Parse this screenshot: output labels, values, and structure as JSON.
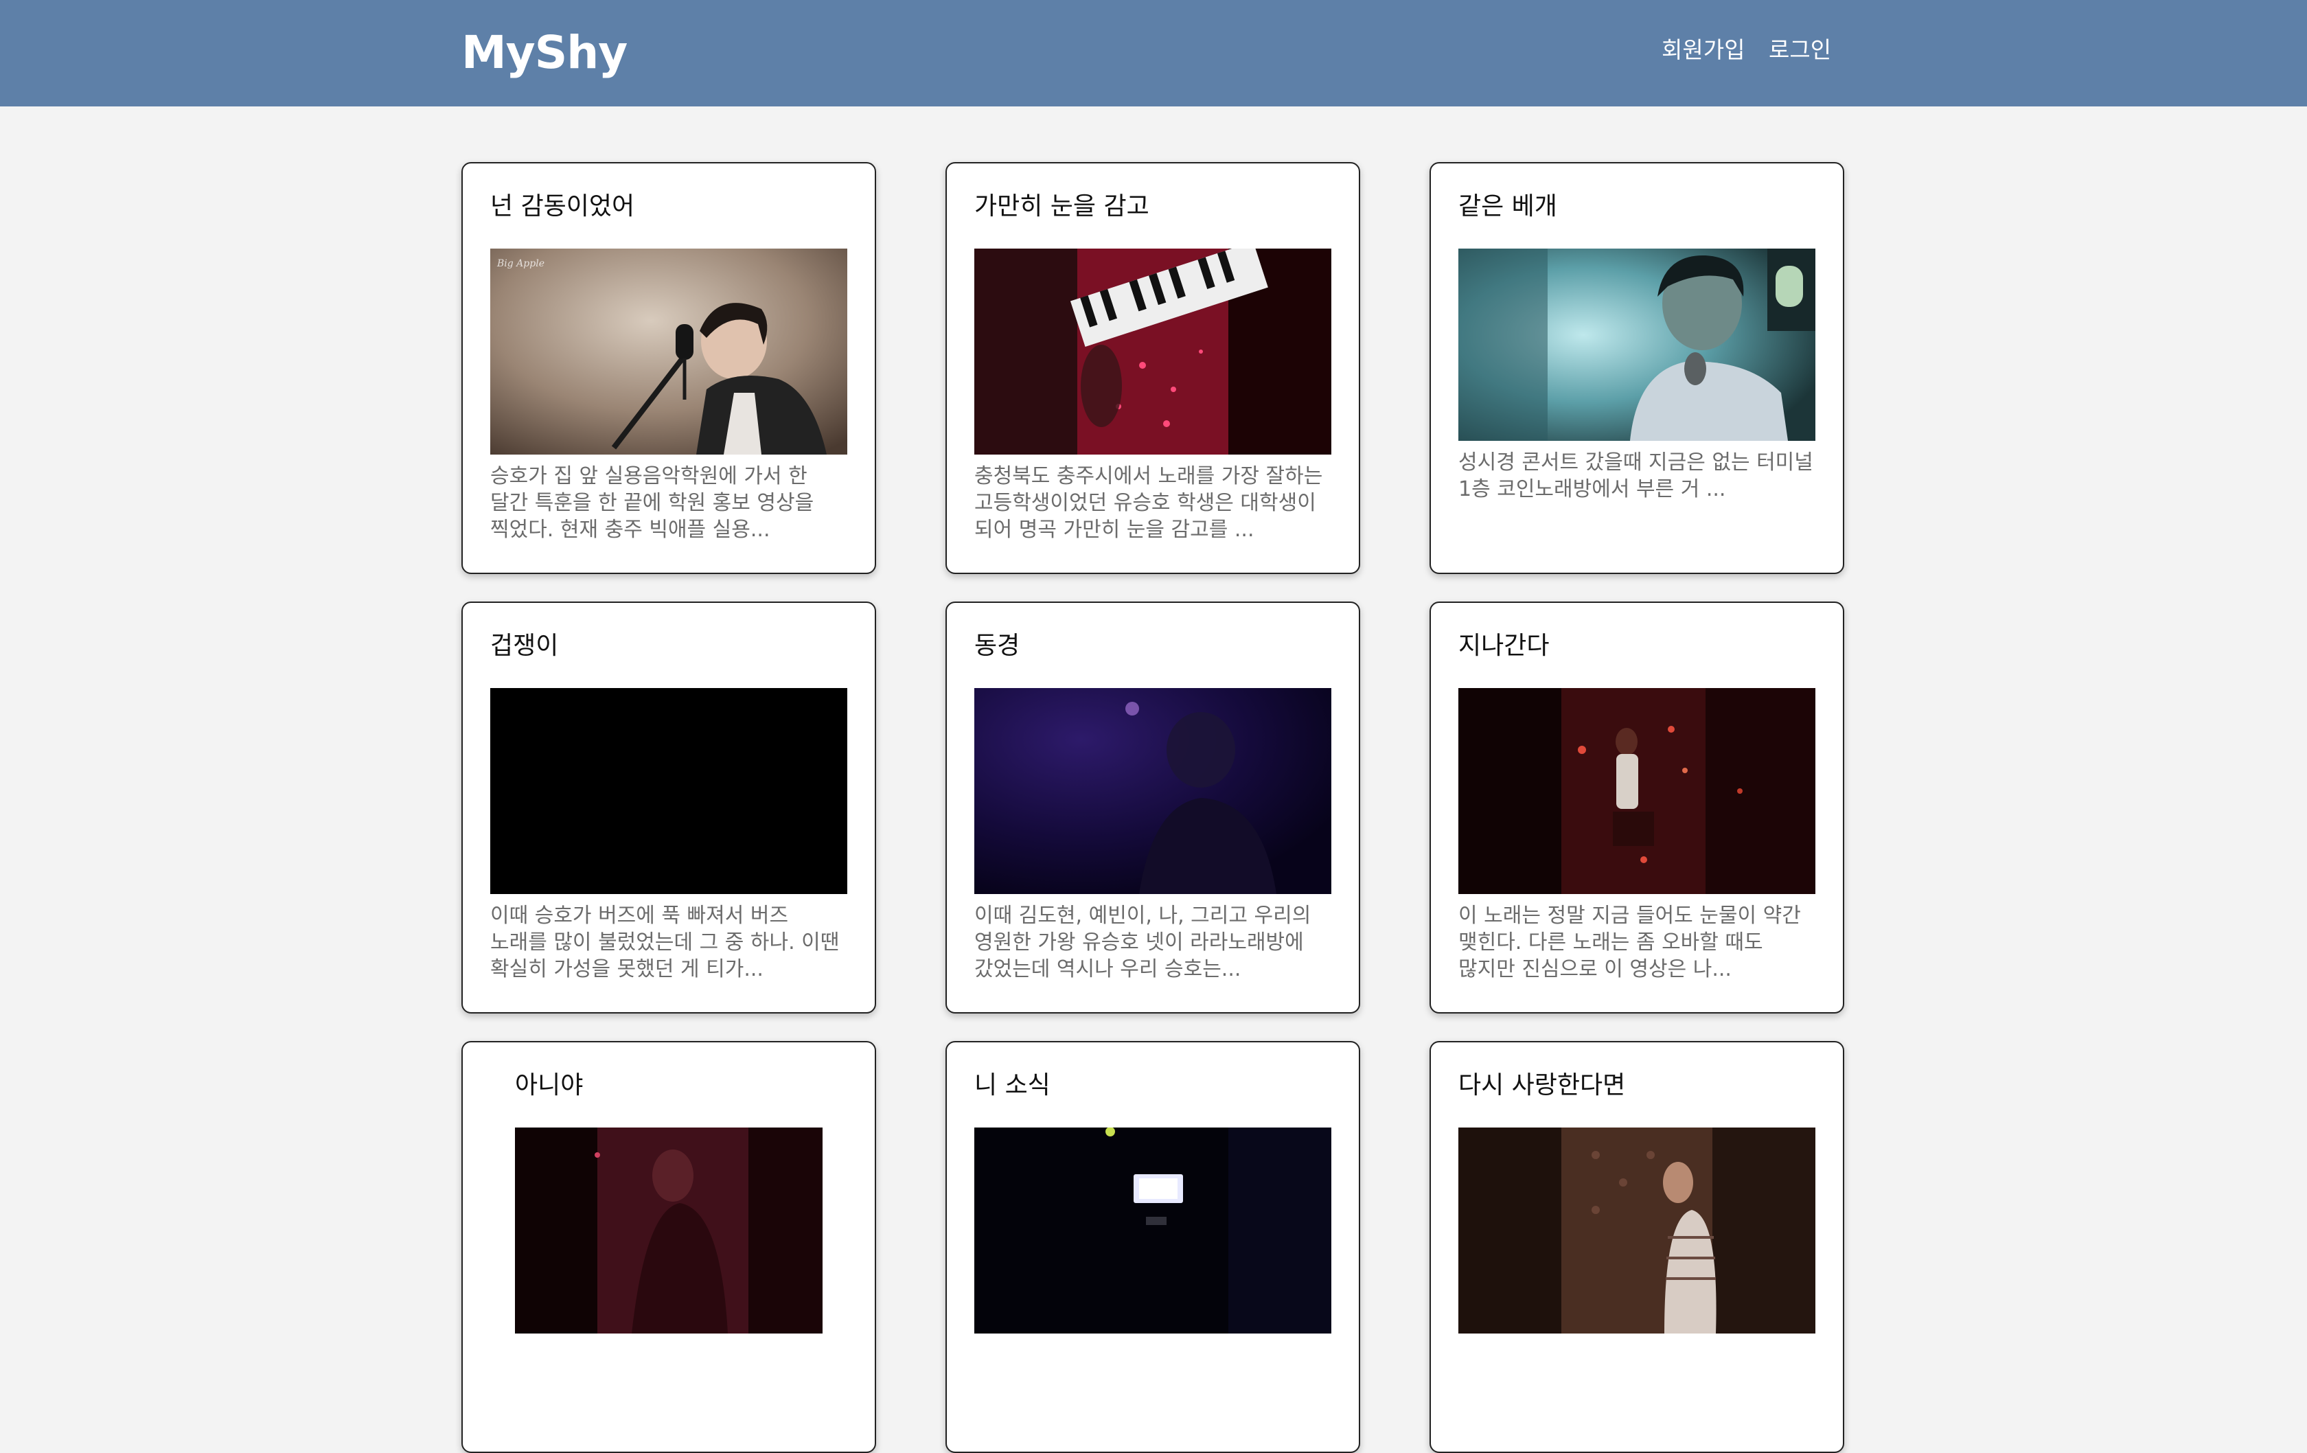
{
  "navbar": {
    "brand": "MyShy",
    "links": {
      "signup": "회원가입",
      "login": "로그인"
    },
    "background": "#5e80a8"
  },
  "cards": [
    {
      "title": "넌 감동이었어",
      "description": "승호가 집 앞 실용음악학원에 가서 한 달간 특훈을 한 끝에 학원 홍보 영상을 찍었다. 현재 충주 빅애플 실용...",
      "watermark": "Big Apple"
    },
    {
      "title": "가만히 눈을 감고",
      "description": "충청북도 충주시에서 노래를 가장 잘하는 고등학생이었던 유승호 학생은 대학생이 되어 명곡 가만히 눈을 감고를 ..."
    },
    {
      "title": "같은 베개",
      "description": "성시경 콘서트 갔을때 지금은 없는 터미널 1층 코인노래방에서 부른 거 ..."
    },
    {
      "title": "겁쟁이",
      "description": "이때 승호가 버즈에 푹 빠져서 버즈 노래를 많이 불렀었는데 그 중 하나. 이땐 확실히 가성을 못했던 게 티가..."
    },
    {
      "title": "동경",
      "description": "이때 김도현, 예빈이, 나, 그리고 우리의 영원한 가왕 유승호 넷이 라라노래방에 갔었는데 역시나 우리 승호는..."
    },
    {
      "title": "지나간다",
      "description": "이 노래는 정말 지금 들어도 눈물이 약간 맺힌다. 다른 노래는 좀 오바할 때도 많지만 진심으로 이 영상은 나..."
    },
    {
      "title": "아니야",
      "description": ""
    },
    {
      "title": "니 소식",
      "description": ""
    },
    {
      "title": "다시 사랑한다면",
      "description": ""
    }
  ]
}
